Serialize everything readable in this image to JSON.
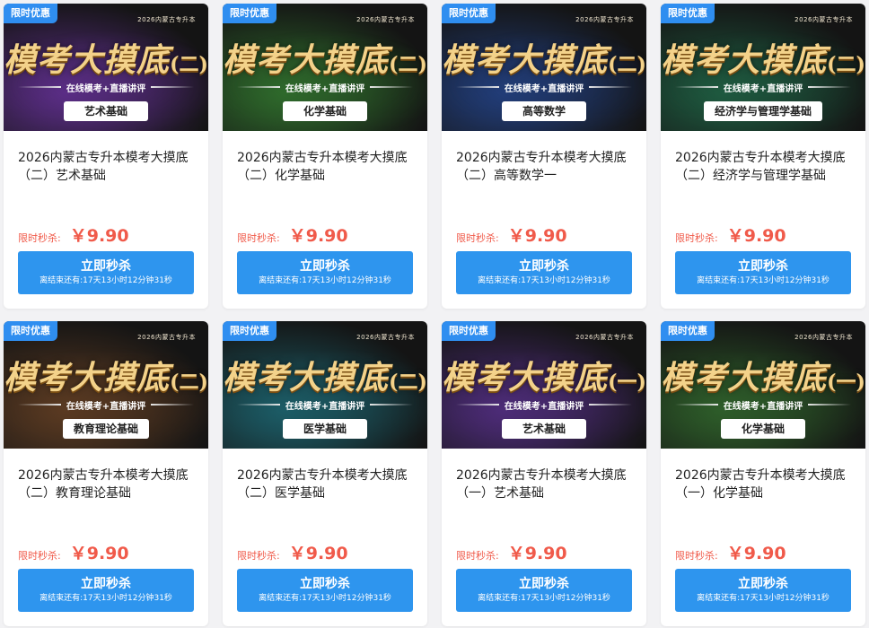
{
  "common": {
    "badge": "限时优惠",
    "top_tag": "2026内蒙古专升本",
    "subline": "在线模考+直播讲评",
    "price_label": "限时秒杀:",
    "price": "￥9.90",
    "button_label": "立即秒杀",
    "countdown": "离结束还有:17天13小时12分钟31秒"
  },
  "cards": [
    {
      "banner_title": "模考大摸底",
      "banner_part": "(二)",
      "subject": "艺术基础",
      "name": "2026内蒙古专升本模考大摸底（二）艺术基础",
      "theme": "#5b2e86"
    },
    {
      "banner_title": "模考大摸底",
      "banner_part": "(二)",
      "subject": "化学基础",
      "name": "2026内蒙古专升本模考大摸底（二）化学基础",
      "theme": "#2f6a2c"
    },
    {
      "banner_title": "模考大摸底",
      "banner_part": "(二)",
      "subject": "高等数学",
      "name": "2026内蒙古专升本模考大摸底（二）高等数学一",
      "theme": "#223d78"
    },
    {
      "banner_title": "模考大摸底",
      "banner_part": "(二)",
      "subject": "经济学与管理学基础",
      "name": "2026内蒙古专升本模考大摸底（二）经济学与管理学基础",
      "theme": "#1f5a40"
    },
    {
      "banner_title": "模考大摸底",
      "banner_part": "(二)",
      "subject": "教育理论基础",
      "name": "2026内蒙古专升本模考大摸底（二）教育理论基础",
      "theme": "#5a3a22"
    },
    {
      "banner_title": "模考大摸底",
      "banner_part": "(二)",
      "subject": "医学基础",
      "name": "2026内蒙古专升本模考大摸底（二）医学基础",
      "theme": "#1c5c66"
    },
    {
      "banner_title": "模考大摸底",
      "banner_part": "(一)",
      "subject": "艺术基础",
      "name": "2026内蒙古专升本模考大摸底（一）艺术基础",
      "theme": "#4d2c78"
    },
    {
      "banner_title": "模考大摸底",
      "banner_part": "(一)",
      "subject": "化学基础",
      "name": "2026内蒙古专升本模考大摸底（一）化学基础",
      "theme": "#2e5d2a"
    }
  ]
}
